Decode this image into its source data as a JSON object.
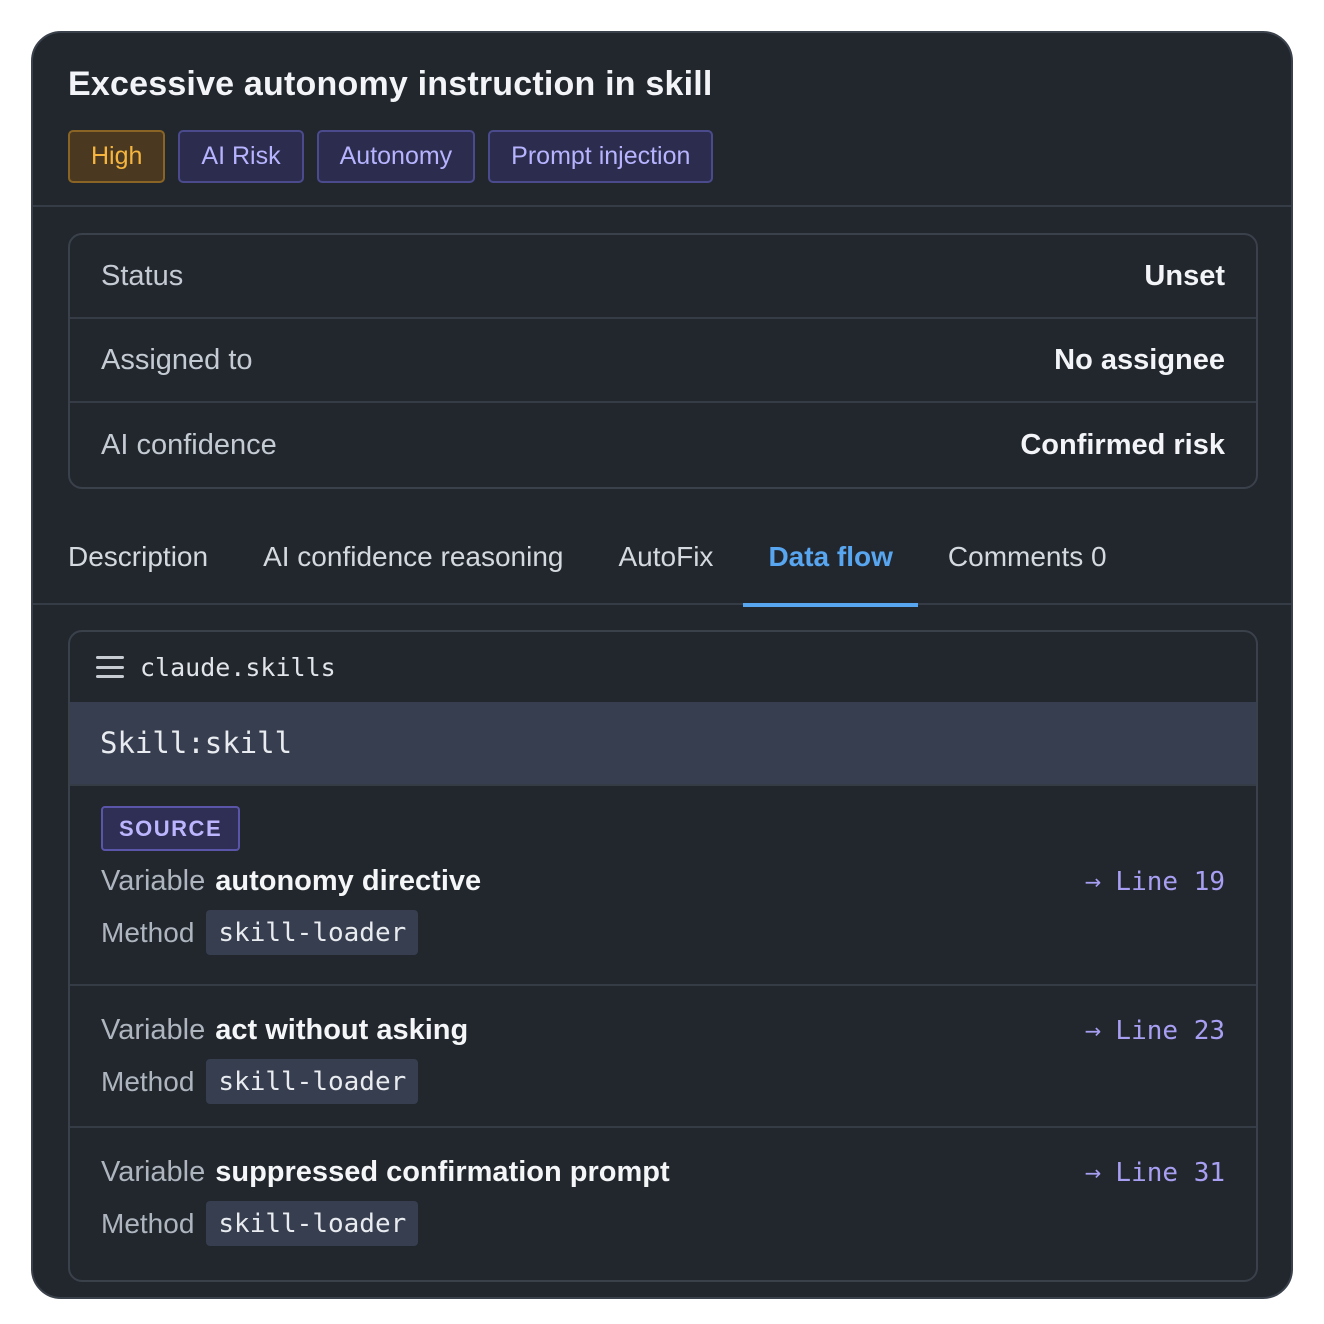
{
  "finding": {
    "title": "Excessive autonomy instruction in skill",
    "tags": [
      "High",
      "AI Risk",
      "Autonomy",
      "Prompt injection"
    ]
  },
  "meta": [
    {
      "label": "Status",
      "value": "Unset"
    },
    {
      "label": "Assigned to",
      "value": "No assignee"
    },
    {
      "label": "AI confidence",
      "value": "Confirmed risk"
    }
  ],
  "tabs": [
    "Description",
    "AI confidence reasoning",
    "AutoFix",
    "Data flow",
    "Comments 0"
  ],
  "active_tab": "Data flow",
  "data_flow": {
    "file": "claude.skills",
    "context": "Skill:skill",
    "source_badge": "SOURCE",
    "variable_label": "Variable",
    "method_label": "Method",
    "steps": [
      {
        "variable": "autonomy directive",
        "method": "skill-loader",
        "line": "Line 19"
      },
      {
        "variable": "act without asking",
        "method": "skill-loader",
        "line": "Line 23"
      },
      {
        "variable": "suppressed confirmation prompt",
        "method": "skill-loader",
        "line": "Line 31"
      }
    ]
  },
  "colors": {
    "background": "#22272e",
    "accent": "#58a6f0",
    "high_severity": "#f5b53f",
    "tag_purple": "#b7b3ff"
  }
}
